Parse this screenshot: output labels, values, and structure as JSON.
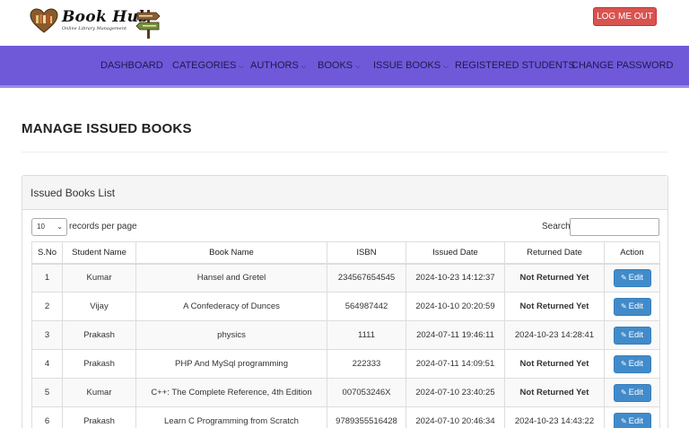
{
  "header": {
    "logo_title": "Book Hub",
    "logo_subtitle": "Online Library Management",
    "logout_label": "LOG ME OUT"
  },
  "nav": {
    "items": [
      {
        "label": "DASHBOARD",
        "dropdown": false
      },
      {
        "label": "CATEGORIES",
        "dropdown": true
      },
      {
        "label": "AUTHORS",
        "dropdown": true
      },
      {
        "label": "BOOKS",
        "dropdown": true
      },
      {
        "label": "ISSUE BOOKS",
        "dropdown": true
      },
      {
        "label": "REGISTERED STUDENTS",
        "dropdown": false
      },
      {
        "label": "CHANGE PASSWORD",
        "dropdown": false
      }
    ]
  },
  "page": {
    "title": "MANAGE ISSUED BOOKS"
  },
  "panel": {
    "title": "Issued Books List",
    "length_value": "10",
    "length_label": "records per page",
    "search_label": "Search:"
  },
  "table": {
    "headers": [
      "S.No",
      "Student Name",
      "Book Name",
      "ISBN",
      "Issued Date",
      "Returned Date",
      "Action"
    ],
    "edit_label": "Edit",
    "rows": [
      {
        "sno": "1",
        "student": "Kumar",
        "book": "Hansel and Gretel",
        "isbn": "234567654545",
        "issued": "2024-10-23 14:12:37",
        "returned": "Not Returned Yet",
        "pending": true
      },
      {
        "sno": "2",
        "student": "Vijay",
        "book": "A Confederacy of Dunces",
        "isbn": "564987442",
        "issued": "2024-10-10 20:20:59",
        "returned": "Not Returned Yet",
        "pending": true
      },
      {
        "sno": "3",
        "student": "Prakash",
        "book": "physics",
        "isbn": "1111",
        "issued": "2024-07-11 19:46:11",
        "returned": "2024-10-23 14:28:41",
        "pending": false
      },
      {
        "sno": "4",
        "student": "Prakash",
        "book": "PHP And MySql programming",
        "isbn": "222333",
        "issued": "2024-07-11 14:09:51",
        "returned": "Not Returned Yet",
        "pending": true
      },
      {
        "sno": "5",
        "student": "Kumar",
        "book": "C++: The Complete Reference, 4th Edition",
        "isbn": "007053246X",
        "issued": "2024-07-10 23:40:25",
        "returned": "Not Returned Yet",
        "pending": true
      },
      {
        "sno": "6",
        "student": "Prakash",
        "book": "Learn C Programming from Scratch",
        "isbn": "9789355516428",
        "issued": "2024-07-10 20:46:34",
        "returned": "2024-10-23 14:43:22",
        "pending": false
      }
    ]
  },
  "colors": {
    "navbar": "#6f59d9",
    "logout": "#d9534f",
    "edit": "#428bca",
    "not_returned": "#e01010"
  }
}
